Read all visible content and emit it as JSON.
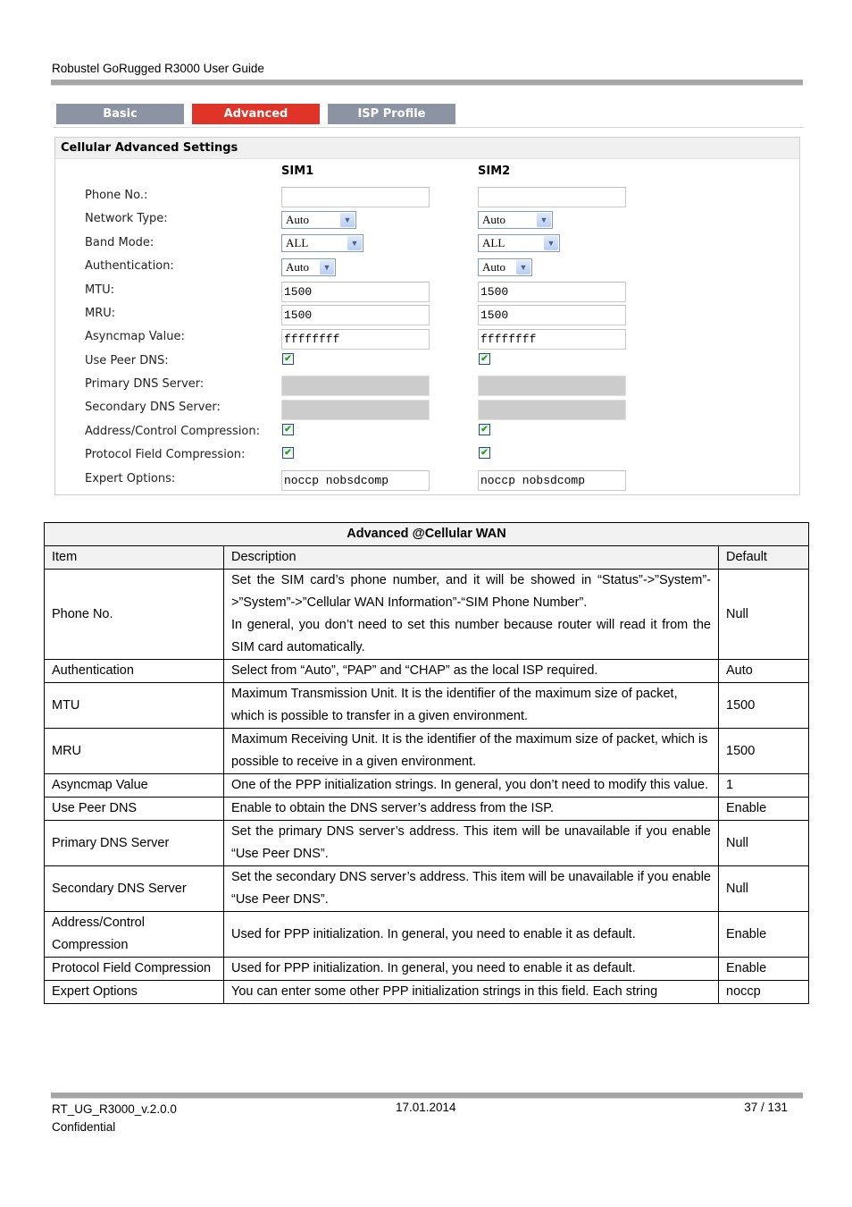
{
  "header": {
    "title": "Robustel GoRugged R3000 User Guide"
  },
  "ui": {
    "tabs": [
      {
        "label": "Basic",
        "active": false
      },
      {
        "label": "Advanced",
        "active": true
      },
      {
        "label": "ISP Profile",
        "active": false
      }
    ],
    "accent_color": "#df3427",
    "panel_title": "Cellular Advanced Settings",
    "columns": [
      "SIM1",
      "SIM2"
    ],
    "labels": {
      "phone": "Phone No.:",
      "network_type": "Network Type:",
      "band_mode": "Band Mode:",
      "authentication": "Authentication:",
      "mtu": "MTU:",
      "mru": "MRU:",
      "asyncmap": "Asyncmap Value:",
      "use_peer_dns": "Use Peer DNS:",
      "primary_dns": "Primary DNS Server:",
      "secondary_dns": "Secondary DNS Server:",
      "acc": "Address/Control Compression:",
      "pfc": "Protocol Field Compression:",
      "expert": "Expert Options:"
    },
    "sim1": {
      "phone": "",
      "network_type": "Auto",
      "band_mode": "ALL",
      "authentication": "Auto",
      "mtu": "1500",
      "mru": "1500",
      "asyncmap": "ffffffff",
      "use_peer_dns": true,
      "primary_dns": "",
      "secondary_dns": "",
      "acc": true,
      "pfc": true,
      "expert": "noccp nobsdcomp"
    },
    "sim2": {
      "phone": "",
      "network_type": "Auto",
      "band_mode": "ALL",
      "authentication": "Auto",
      "mtu": "1500",
      "mru": "1500",
      "asyncmap": "ffffffff",
      "use_peer_dns": true,
      "primary_dns": "",
      "secondary_dns": "",
      "acc": true,
      "pfc": true,
      "expert": "noccp nobsdcomp"
    },
    "check_glyph": "✔",
    "arrow_glyph": "▼"
  },
  "table": {
    "title": "Advanced @Cellular WAN",
    "headers": [
      "Item",
      "Description",
      "Default"
    ],
    "rows": [
      {
        "item": "Phone No.",
        "desc1": "Set the SIM card’s phone number, and it will be showed in “Status”->”System”->”System”->”Cellular WAN Information”-“SIM Phone Number”.",
        "desc2": "In general, you don’t need to set this number because router will read it from the SIM card automatically.",
        "default": "Null"
      },
      {
        "item": "Authentication",
        "desc1": "Select from “Auto”, “PAP” and “CHAP” as the local ISP required.",
        "default": "Auto"
      },
      {
        "item": "MTU",
        "desc1": "Maximum Transmission Unit. It is the identifier of the maximum size of packet, which is possible to transfer in a given environment.",
        "default": "1500"
      },
      {
        "item": "MRU",
        "desc1": "Maximum Receiving Unit. It is the identifier of the maximum size of packet, which is possible to receive in a given environment.",
        "default": "1500"
      },
      {
        "item": "Asyncmap Value",
        "desc1": "One of the PPP initialization strings. In general, you don’t need to modify this value.",
        "default": "1"
      },
      {
        "item": "Use Peer DNS",
        "desc1": "Enable to obtain the DNS server’s address from the ISP.",
        "default": "Enable"
      },
      {
        "item": "Primary DNS Server",
        "desc1": "Set the primary DNS server’s address. This item will be unavailable if you enable “Use Peer DNS”.",
        "default": "Null"
      },
      {
        "item": "Secondary DNS Server",
        "desc1": "Set the secondary DNS server’s address. This item will be unavailable if you enable “Use Peer DNS”.",
        "default": "Null"
      },
      {
        "item": "Address/Control Compression",
        "desc1": "Used for PPP initialization. In general, you need to enable it as default.",
        "default": "Enable"
      },
      {
        "item": "Protocol Field Compression",
        "desc1": "Used for PPP initialization. In general, you need to enable it as default.",
        "default": "Enable"
      },
      {
        "item": "Expert Options",
        "desc1": "You can enter some other PPP initialization strings in this field. Each string",
        "default": "noccp"
      }
    ]
  },
  "footer": {
    "doc_id": "RT_UG_R3000_v.2.0.0",
    "classification": "Confidential",
    "date": "17.01.2014",
    "page": "37 / 131"
  }
}
